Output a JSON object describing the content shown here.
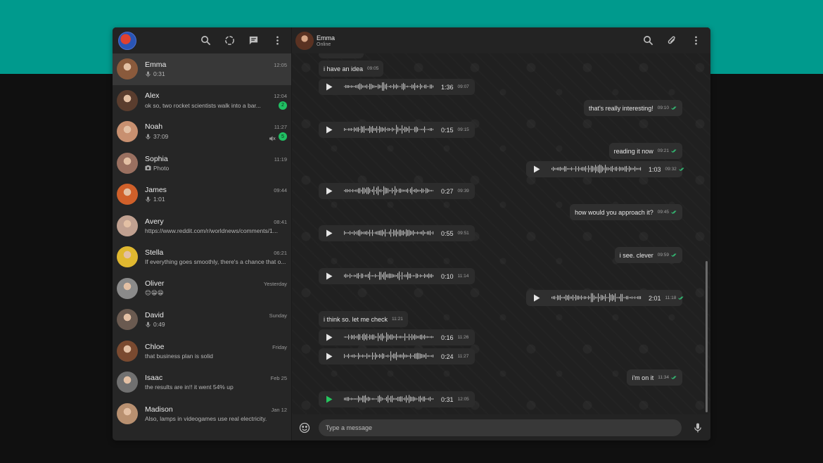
{
  "header": {
    "contact_name": "Emma",
    "contact_status": "Online"
  },
  "chats": [
    {
      "name": "Emma",
      "time": "12:05",
      "preview": "0:31",
      "preview_icon": "mic-icon",
      "badge": "",
      "muted": false,
      "active": true,
      "avatar_color": "#8a5a3c"
    },
    {
      "name": "Alex",
      "time": "12:04",
      "preview": "ok so, two rocket scientists walk into a bar...",
      "preview_icon": "",
      "badge": "2",
      "muted": false,
      "active": false,
      "avatar_color": "#5a3d2e"
    },
    {
      "name": "Noah",
      "time": "11:27",
      "preview": "37:09",
      "preview_icon": "mic-icon",
      "badge": "5",
      "muted": true,
      "active": false,
      "avatar_color": "#c89070"
    },
    {
      "name": "Sophia",
      "time": "11:19",
      "preview": "Photo",
      "preview_icon": "photo-icon",
      "badge": "",
      "muted": false,
      "active": false,
      "avatar_color": "#9a7060"
    },
    {
      "name": "James",
      "time": "09:44",
      "preview": "1:01",
      "preview_icon": "mic-icon",
      "badge": "",
      "muted": false,
      "active": false,
      "avatar_color": "#d0602a"
    },
    {
      "name": "Avery",
      "time": "08:41",
      "preview": "https://www.reddit.com/r/worldnews/comments/1...",
      "preview_icon": "",
      "badge": "",
      "muted": false,
      "active": false,
      "avatar_color": "#c0a090"
    },
    {
      "name": "Stella",
      "time": "06:21",
      "preview": "If everything goes smoothly, there's a chance that o...",
      "preview_icon": "",
      "badge": "",
      "muted": false,
      "active": false,
      "avatar_color": "#e0b830"
    },
    {
      "name": "Oliver",
      "time": "Yesterday",
      "preview": "😊😁😁",
      "preview_icon": "",
      "badge": "",
      "muted": false,
      "active": false,
      "avatar_color": "#8a8a8a"
    },
    {
      "name": "David",
      "time": "Sunday",
      "preview": "0:49",
      "preview_icon": "mic-icon",
      "badge": "",
      "muted": false,
      "active": false,
      "avatar_color": "#6a5a50"
    },
    {
      "name": "Chloe",
      "time": "Friday",
      "preview": "that business plan is solid",
      "preview_icon": "",
      "badge": "",
      "muted": false,
      "active": false,
      "avatar_color": "#7a4a30"
    },
    {
      "name": "Isaac",
      "time": "Feb 25",
      "preview": "the results are in!! it went 54% up",
      "preview_icon": "",
      "badge": "",
      "muted": false,
      "active": false,
      "avatar_color": "#707070"
    },
    {
      "name": "Madison",
      "time": "Jan 12",
      "preview": "Also, lamps in videogames use real electricity.",
      "preview_icon": "",
      "badge": "",
      "muted": false,
      "active": false,
      "avatar_color": "#b89070"
    }
  ],
  "messages": [
    {
      "kind": "text",
      "dir": "in",
      "text": "i have an idea",
      "time": "09:05"
    },
    {
      "kind": "voice",
      "dir": "in",
      "duration": "1:36",
      "time": "09:07"
    },
    {
      "kind": "text",
      "dir": "out",
      "text": "that's really interesting!",
      "time": "09:10"
    },
    {
      "kind": "voice",
      "dir": "in",
      "duration": "0:15",
      "time": "09:15"
    },
    {
      "kind": "text",
      "dir": "out",
      "text": "reading it now",
      "time": "09:21"
    },
    {
      "kind": "voice",
      "dir": "out",
      "duration": "1:03",
      "time": "09:32"
    },
    {
      "kind": "voice",
      "dir": "in",
      "duration": "0:27",
      "time": "09:39"
    },
    {
      "kind": "text",
      "dir": "out",
      "text": "how would you approach it?",
      "time": "09:45"
    },
    {
      "kind": "voice",
      "dir": "in",
      "duration": "0:55",
      "time": "09:51"
    },
    {
      "kind": "text",
      "dir": "out",
      "text": "i see. clever",
      "time": "09:59"
    },
    {
      "kind": "voice",
      "dir": "in",
      "duration": "0:10",
      "time": "11:14"
    },
    {
      "kind": "voice",
      "dir": "out",
      "duration": "2:01",
      "time": "11:18"
    },
    {
      "kind": "text",
      "dir": "in",
      "text": "i think so. let me check",
      "time": "11:21"
    },
    {
      "kind": "voice",
      "dir": "in",
      "duration": "0:16",
      "time": "11:26"
    },
    {
      "kind": "voice",
      "dir": "in",
      "duration": "0:24",
      "time": "11:27"
    },
    {
      "kind": "text",
      "dir": "out",
      "text": "i'm on it",
      "time": "11:34"
    },
    {
      "kind": "voice",
      "dir": "in",
      "duration": "0:31",
      "time": "12:05",
      "playing": true
    }
  ],
  "composer": {
    "placeholder": "Type a message"
  },
  "colors": {
    "brand_band": "#009a8d",
    "accent_green": "#25c65e",
    "read_ticks": "#34c77a"
  }
}
